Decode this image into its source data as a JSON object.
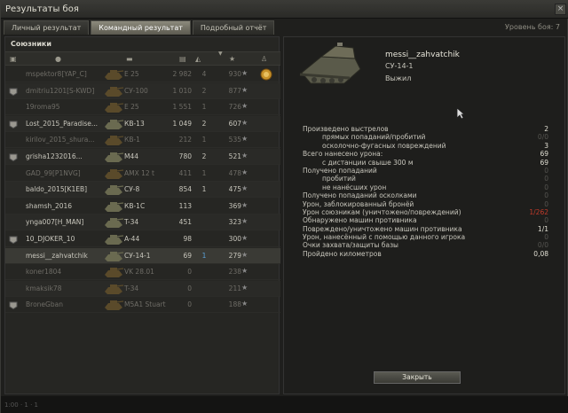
{
  "window": {
    "title": "Результаты боя",
    "battle_level": "Уровень боя: 7",
    "close_glyph": "×"
  },
  "tabs": [
    {
      "label": "Личный результат"
    },
    {
      "label": "Командный результат"
    },
    {
      "label": "Подробный отчёт"
    }
  ],
  "allies": {
    "title": "Союзники",
    "header_icons": [
      "platoon-icon",
      "player-icon",
      "tank-icon",
      "damage-icon",
      "kills-icon",
      "sort-arrow-icon",
      "xp-star-icon",
      "medal-icon"
    ],
    "rows": [
      {
        "name": "mspektor8[YAP_C]",
        "vehicle": "E 25",
        "damage": "2 982",
        "kills": "4",
        "xp": "930",
        "platoon": false,
        "dead": true,
        "medal": true
      },
      {
        "name": "dmitriu1201[S-KWD]",
        "vehicle": "СУ-100",
        "damage": "1 010",
        "kills": "2",
        "xp": "877",
        "platoon": true,
        "dead": true,
        "medal": false
      },
      {
        "name": "19roma95",
        "vehicle": "E 25",
        "damage": "1 551",
        "kills": "1",
        "xp": "726",
        "platoon": false,
        "dead": true,
        "medal": false
      },
      {
        "name": "Lost_2015_Paradise...",
        "vehicle": "КВ-13",
        "damage": "1 049",
        "kills": "2",
        "xp": "607",
        "platoon": true,
        "dead": false,
        "medal": false
      },
      {
        "name": "kirilov_2015_shura...",
        "vehicle": "КВ-1",
        "damage": "212",
        "kills": "1",
        "xp": "535",
        "platoon": false,
        "dead": true,
        "medal": false
      },
      {
        "name": "grisha1232016...",
        "vehicle": "M44",
        "damage": "780",
        "kills": "2",
        "xp": "521",
        "platoon": true,
        "dead": false,
        "medal": false
      },
      {
        "name": "GAD_99[P1NVG]",
        "vehicle": "AMX 12 t",
        "damage": "411",
        "kills": "1",
        "xp": "478",
        "platoon": false,
        "dead": true,
        "medal": false
      },
      {
        "name": "baldo_2015[K1EB]",
        "vehicle": "СУ-8",
        "damage": "854",
        "kills": "1",
        "xp": "475",
        "platoon": false,
        "dead": false,
        "medal": false
      },
      {
        "name": "shamsh_2016",
        "vehicle": "КВ-1С",
        "damage": "113",
        "kills": "",
        "xp": "369",
        "platoon": false,
        "dead": false,
        "medal": false
      },
      {
        "name": "ynga007[H_MAN]",
        "vehicle": "T-34",
        "damage": "451",
        "kills": "",
        "xp": "323",
        "platoon": false,
        "dead": false,
        "medal": false
      },
      {
        "name": "10_DJOKER_10",
        "vehicle": "A-44",
        "damage": "98",
        "kills": "",
        "xp": "300",
        "platoon": true,
        "dead": false,
        "medal": false
      },
      {
        "name": "messi__zahvatchik",
        "vehicle": "СУ-14-1",
        "damage": "69",
        "kills": "1",
        "xp": "279",
        "platoon": false,
        "dead": false,
        "medal": false,
        "selected": true
      },
      {
        "name": "koner1804",
        "vehicle": "VK 28.01",
        "damage": "0",
        "kills": "",
        "xp": "238",
        "platoon": false,
        "dead": true,
        "medal": false
      },
      {
        "name": "kmaksik78",
        "vehicle": "T-34",
        "damage": "0",
        "kills": "",
        "xp": "211",
        "platoon": false,
        "dead": true,
        "medal": false
      },
      {
        "name": "BroneGban",
        "vehicle": "M5A1 Stuart",
        "damage": "0",
        "kills": "",
        "xp": "188",
        "platoon": true,
        "dead": true,
        "medal": false
      }
    ]
  },
  "detail": {
    "player_name": "messi__zahvatchik",
    "vehicle_name": "СУ-14-1",
    "status": "Выжил",
    "stats": [
      {
        "label": "Произведено выстрелов",
        "value": "2",
        "sub": false,
        "style": "normal"
      },
      {
        "label": "прямых попаданий/пробитий",
        "value": "0/0",
        "sub": true,
        "style": "zero"
      },
      {
        "label": "осколочно-фугасных повреждений",
        "value": "3",
        "sub": true,
        "style": "normal"
      },
      {
        "label": "Всего нанесено урона:",
        "value": "69",
        "sub": false,
        "style": "normal"
      },
      {
        "label": "с дистанции свыше 300 м",
        "value": "69",
        "sub": true,
        "style": "normal"
      },
      {
        "label": "Получено попаданий",
        "value": "0",
        "sub": false,
        "style": "zero"
      },
      {
        "label": "пробитий",
        "value": "0",
        "sub": true,
        "style": "zero"
      },
      {
        "label": "не нанёсших урон",
        "value": "0",
        "sub": true,
        "style": "zero"
      },
      {
        "label": "Получено попаданий осколками",
        "value": "0",
        "sub": false,
        "style": "zero"
      },
      {
        "label": "Урон, заблокированный бронёй",
        "value": "0",
        "sub": false,
        "style": "zero"
      },
      {
        "label": "Урон союзникам (уничтожено/повреждений)",
        "value": "1/262",
        "sub": false,
        "style": "red"
      },
      {
        "label": "Обнаружено машин противника",
        "value": "0",
        "sub": false,
        "style": "zero"
      },
      {
        "label": "Повреждено/уничтожено машин противника",
        "value": "1/1",
        "sub": false,
        "style": "normal"
      },
      {
        "label": "Урон, нанесённый с помощью данного игрока",
        "value": "0",
        "sub": false,
        "style": "zero"
      },
      {
        "label": "Очки захвата/защиты базы",
        "value": "0/0",
        "sub": false,
        "style": "zero"
      },
      {
        "label": "Пройдено километров",
        "value": "0,08",
        "sub": false,
        "style": "normal"
      }
    ],
    "close_button": "Закрыть"
  },
  "footer": {
    "text": "1:00 · 1 · 1"
  }
}
